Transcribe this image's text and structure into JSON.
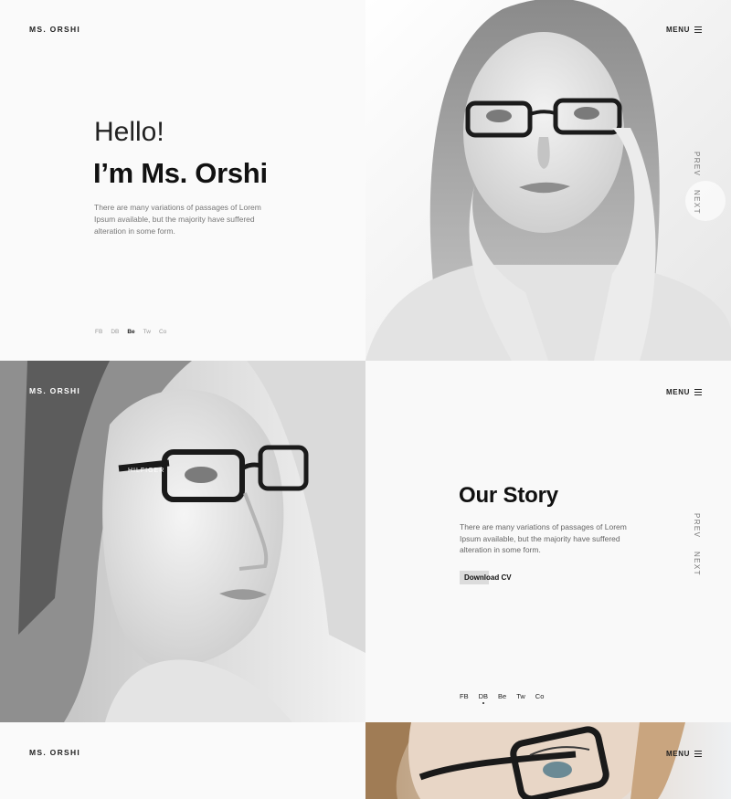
{
  "brand": {
    "logo_top": "MS. ORSHI",
    "logo_middle": "MS. ORSHI",
    "logo_bottom": "MS. ORSHI"
  },
  "menu": {
    "label_top": "MENU",
    "label_middle": "MENU",
    "label_bottom": "MENU"
  },
  "hero": {
    "greeting": "Hello!",
    "name": "I’m Ms. Orshi",
    "intro": "There are many variations of passages of Lorem Ipsum available, but the majority have suffered alteration in some form."
  },
  "social_top": [
    "FB",
    "DB",
    "Be",
    "Tw",
    "Co"
  ],
  "social_top_active": 2,
  "slider_nav_top": {
    "prev": "PREV",
    "next": "NEXT"
  },
  "story": {
    "title": "Our Story",
    "text": "There are many variations of passages of Lorem Ipsum available, but the majority have suffered alteration in some form.",
    "cv_button": "Download CV"
  },
  "social_story": [
    "FB",
    "DB",
    "Be",
    "Tw",
    "Co"
  ],
  "social_story_active": 1,
  "slider_nav_story": {
    "prev": "PREV",
    "next": "NEXT"
  },
  "photo_texts": {
    "frame_brand": "HILFIGER"
  },
  "colors": {
    "text_dark": "#111111",
    "text_muted": "#777777",
    "button_bg": "#dcdcdc"
  }
}
